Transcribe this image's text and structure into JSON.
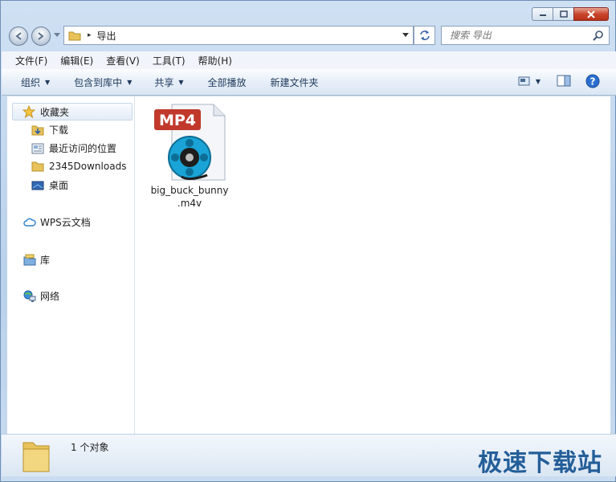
{
  "window": {
    "address": {
      "separator": "▸",
      "current": "导出"
    },
    "search": {
      "placeholder": "搜索 导出"
    }
  },
  "menubar": {
    "items": [
      "文件(F)",
      "编辑(E)",
      "查看(V)",
      "工具(T)",
      "帮助(H)"
    ]
  },
  "toolbar": {
    "organize": "组织",
    "include_in_library": "包含到库中",
    "share": "共享",
    "play_all": "全部播放",
    "new_folder": "新建文件夹"
  },
  "sidebar": {
    "favorites": "收藏夹",
    "fav_items": [
      "下载",
      "最近访问的位置",
      "2345Downloads",
      "桌面"
    ],
    "wps": "WPS云文档",
    "library": "库",
    "network": "网络"
  },
  "files": [
    {
      "name_line1": "big_buck_bunny",
      "name_line2": ".m4v",
      "badge": "MP4"
    }
  ],
  "status": {
    "count": "1 个对象"
  },
  "watermark": "极速下载站",
  "colors": {
    "accent": "#1e395b",
    "mp4_badge": "#c0392b",
    "reel": "#1aa3d6"
  }
}
